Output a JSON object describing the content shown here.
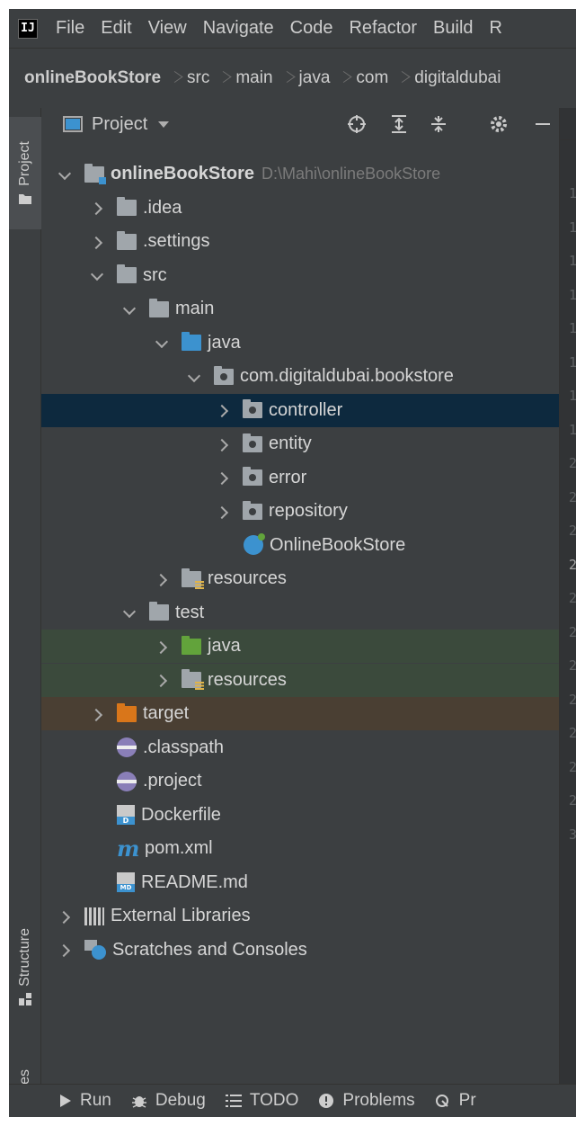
{
  "menu": {
    "logo": "IJ",
    "items": [
      "File",
      "Edit",
      "View",
      "Navigate",
      "Code",
      "Refactor",
      "Build",
      "R"
    ]
  },
  "breadcrumb": [
    "onlineBookStore",
    "src",
    "main",
    "java",
    "com",
    "digitaldubai"
  ],
  "left_tabs": {
    "project": "Project",
    "structure": "Structure",
    "favorites": "Favorites"
  },
  "panel": {
    "title": "Project"
  },
  "tree": {
    "root_label": "onlineBookStore",
    "root_path": "D:\\Mahi\\onlineBookStore",
    "idea": ".idea",
    "settings": ".settings",
    "src": "src",
    "main": "main",
    "java": "java",
    "package": "com.digitaldubai.bookstore",
    "controller": "controller",
    "entity": "entity",
    "error": "error",
    "repository": "repository",
    "app_class": "OnlineBookStore",
    "resources": "resources",
    "test": "test",
    "test_java": "java",
    "test_resources": "resources",
    "target": "target",
    "classpath": ".classpath",
    "project_file": ".project",
    "dockerfile": "Dockerfile",
    "pom": "pom.xml",
    "readme": "README.md",
    "external_libs": "External Libraries",
    "scratches": "Scratches and Consoles"
  },
  "gutter": {
    "lines": [
      "1",
      "1",
      "1",
      "1",
      "1",
      "1",
      "1",
      "1",
      "2",
      "2",
      "2",
      "2",
      "2",
      "2",
      "2",
      "2",
      "2",
      "2",
      "2",
      "3"
    ]
  },
  "bottom": {
    "run": "Run",
    "debug": "Debug",
    "todo": "TODO",
    "problems": "Problems",
    "profiler": "Pr"
  },
  "colors": {
    "background": "#3c3f41",
    "selection": "#0d293e",
    "source_folder": "#3c92cf",
    "test_folder": "#62a33b",
    "excluded_folder": "#d9761a"
  }
}
